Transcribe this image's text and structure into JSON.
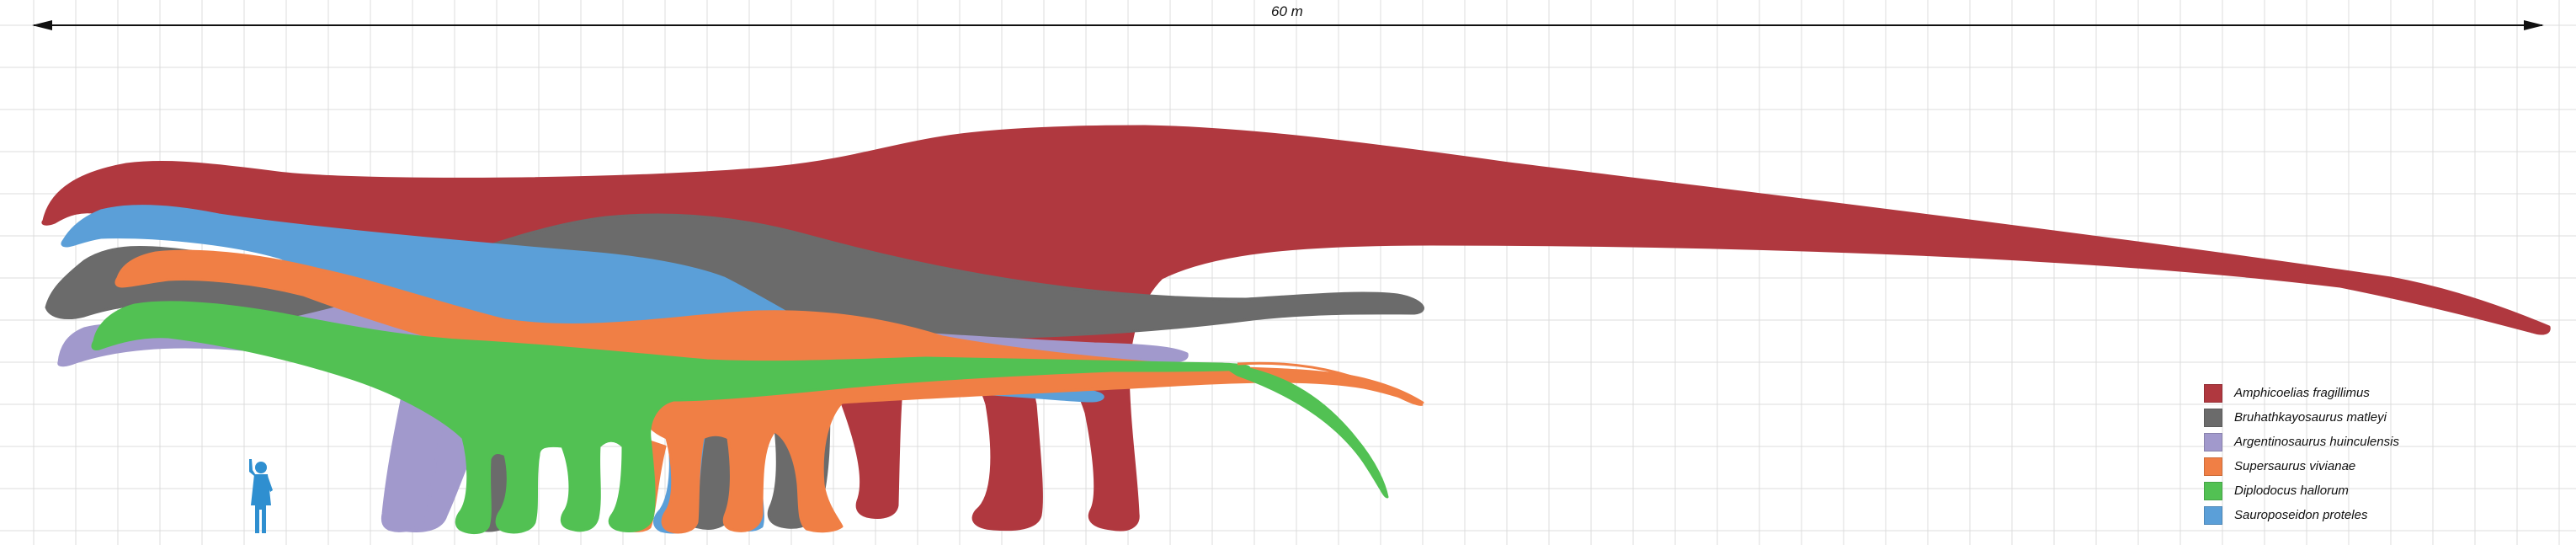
{
  "scale_bar": {
    "label": "60 m"
  },
  "colors": {
    "grid": "#dcdcdc",
    "grid_major": "#cfcfcf",
    "scale_line": "#111111",
    "human": "#2f8fd0"
  },
  "legend": [
    {
      "name": "Amphicoelias fragillimus",
      "color": "#b0383f"
    },
    {
      "name": "Bruhathkayosaurus matleyi",
      "color": "#6b6b6b"
    },
    {
      "name": "Argentinosaurus huinculensis",
      "color": "#a199cc"
    },
    {
      "name": "Supersaurus vivianae",
      "color": "#f07f45"
    },
    {
      "name": "Diplodocus hallorum",
      "color": "#52c153"
    },
    {
      "name": "Sauroposeidon proteles",
      "color": "#5b9fd8"
    }
  ]
}
